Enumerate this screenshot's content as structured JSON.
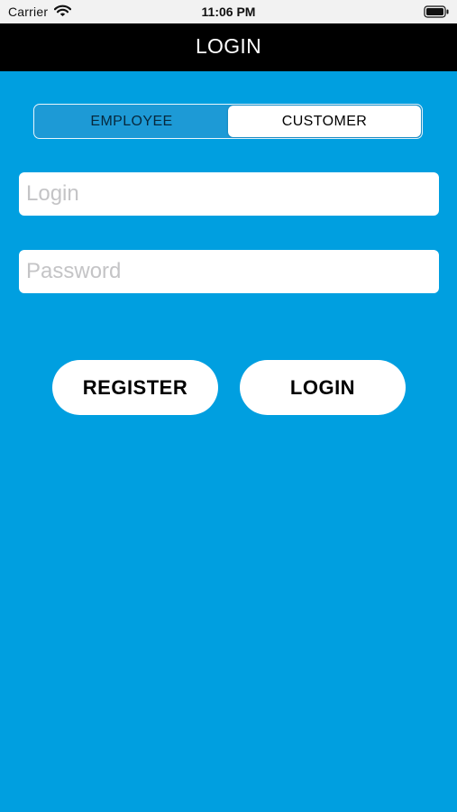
{
  "status_bar": {
    "carrier": "Carrier",
    "time": "11:06 PM",
    "wifi_icon": "wifi-icon",
    "battery_icon": "battery-icon"
  },
  "nav": {
    "title": "LOGIN"
  },
  "user_type": {
    "options": [
      "EMPLOYEE",
      "CUSTOMER"
    ],
    "selected": "CUSTOMER"
  },
  "form": {
    "login": {
      "value": "",
      "placeholder": "Login"
    },
    "password": {
      "value": "",
      "placeholder": "Password"
    }
  },
  "actions": {
    "register_label": "REGISTER",
    "login_label": "LOGIN"
  },
  "colors": {
    "background": "#009fe0",
    "nav_background": "#000000",
    "segment_selected": "#ffffff"
  }
}
